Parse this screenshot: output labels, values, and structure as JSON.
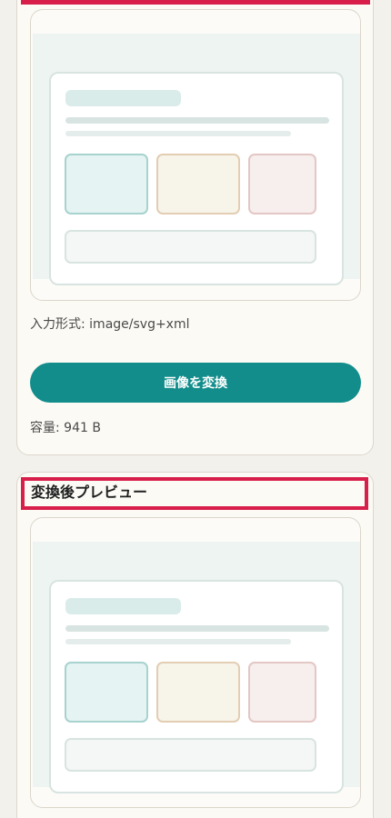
{
  "source_preview": {
    "format_line": "入力形式: image/svg+xml",
    "convert_button_label": "画像を変換",
    "size_line": "容量: 941 B"
  },
  "result_preview": {
    "title": "変換後プレビュー"
  },
  "colors": {
    "accent": "#128d8b",
    "highlight": "#d81e4a",
    "page_background": "#f3f1ec",
    "card_background": "#fbfaf5"
  }
}
